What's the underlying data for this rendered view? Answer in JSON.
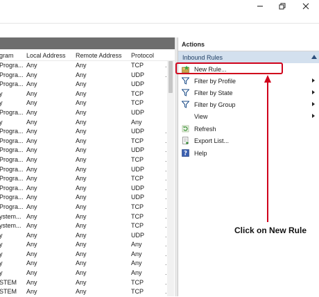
{
  "window": {
    "controls": [
      {
        "name": "minimize-icon",
        "glyph": "minimize"
      },
      {
        "name": "restore-icon",
        "glyph": "restore"
      },
      {
        "name": "close-icon",
        "glyph": "close"
      }
    ]
  },
  "left_pane": {
    "columns": [
      "gram",
      "Local Address",
      "Remote Address",
      "Protocol"
    ],
    "rows": [
      [
        "Progra...",
        "Any",
        "Any",
        "TCP",
        "."
      ],
      [
        "Progra...",
        "Any",
        "Any",
        "UDP",
        "."
      ],
      [
        "Progra...",
        "Any",
        "Any",
        "UDP",
        ""
      ],
      [
        "y",
        "Any",
        "Any",
        "TCP",
        ""
      ],
      [
        "y",
        "Any",
        "Any",
        "TCP",
        ""
      ],
      [
        "Progra...",
        "Any",
        "Any",
        "UDP",
        ""
      ],
      [
        "y",
        "Any",
        "Any",
        "Any",
        ""
      ],
      [
        "Progra...",
        "Any",
        "Any",
        "UDP",
        "."
      ],
      [
        "Progra...",
        "Any",
        "Any",
        "TCP",
        "."
      ],
      [
        "Progra...",
        "Any",
        "Any",
        "UDP",
        "."
      ],
      [
        "Progra...",
        "Any",
        "Any",
        "TCP",
        "."
      ],
      [
        "Progra...",
        "Any",
        "Any",
        "UDP",
        "."
      ],
      [
        "Progra...",
        "Any",
        "Any",
        "TCP",
        "."
      ],
      [
        "Progra...",
        "Any",
        "Any",
        "UDP",
        "."
      ],
      [
        "Progra...",
        "Any",
        "Any",
        "UDP",
        "."
      ],
      [
        "Progra...",
        "Any",
        "Any",
        "TCP",
        "."
      ],
      [
        "ystem...",
        "Any",
        "Any",
        "TCP",
        "."
      ],
      [
        "ystem...",
        "Any",
        "Any",
        "TCP",
        "."
      ],
      [
        "y",
        "Any",
        "Any",
        "UDP",
        "."
      ],
      [
        "y",
        "Any",
        "Any",
        "Any",
        "."
      ],
      [
        "y",
        "Any",
        "Any",
        "Any",
        "."
      ],
      [
        "y",
        "Any",
        "Any",
        "Any",
        "."
      ],
      [
        "y",
        "Any",
        "Any",
        "Any",
        "."
      ],
      [
        "STEM",
        "Any",
        "Any",
        "TCP",
        "."
      ],
      [
        "STEM",
        "Any",
        "Any",
        "TCP",
        "."
      ]
    ]
  },
  "actions": {
    "title": "Actions",
    "section": "Inbound Rules",
    "items": [
      {
        "label": "New Rule...",
        "icon": "new-rule-icon",
        "submenu": false
      },
      {
        "label": "Filter by Profile",
        "icon": "filter-icon",
        "submenu": true
      },
      {
        "label": "Filter by State",
        "icon": "filter-icon",
        "submenu": true
      },
      {
        "label": "Filter by Group",
        "icon": "filter-icon",
        "submenu": true
      },
      {
        "label": "View",
        "icon": "",
        "submenu": true
      },
      {
        "label": "Refresh",
        "icon": "refresh-icon",
        "submenu": false
      },
      {
        "label": "Export List...",
        "icon": "export-list-icon",
        "submenu": false
      },
      {
        "label": "Help",
        "icon": "help-icon",
        "submenu": false
      }
    ]
  },
  "annotation": {
    "text": "Click on New Rule",
    "color": "#d0021b"
  },
  "colors": {
    "section_bg": "#d3e0ee",
    "left_header_bg": "#6e6e6e",
    "highlight": "#d0021b"
  }
}
